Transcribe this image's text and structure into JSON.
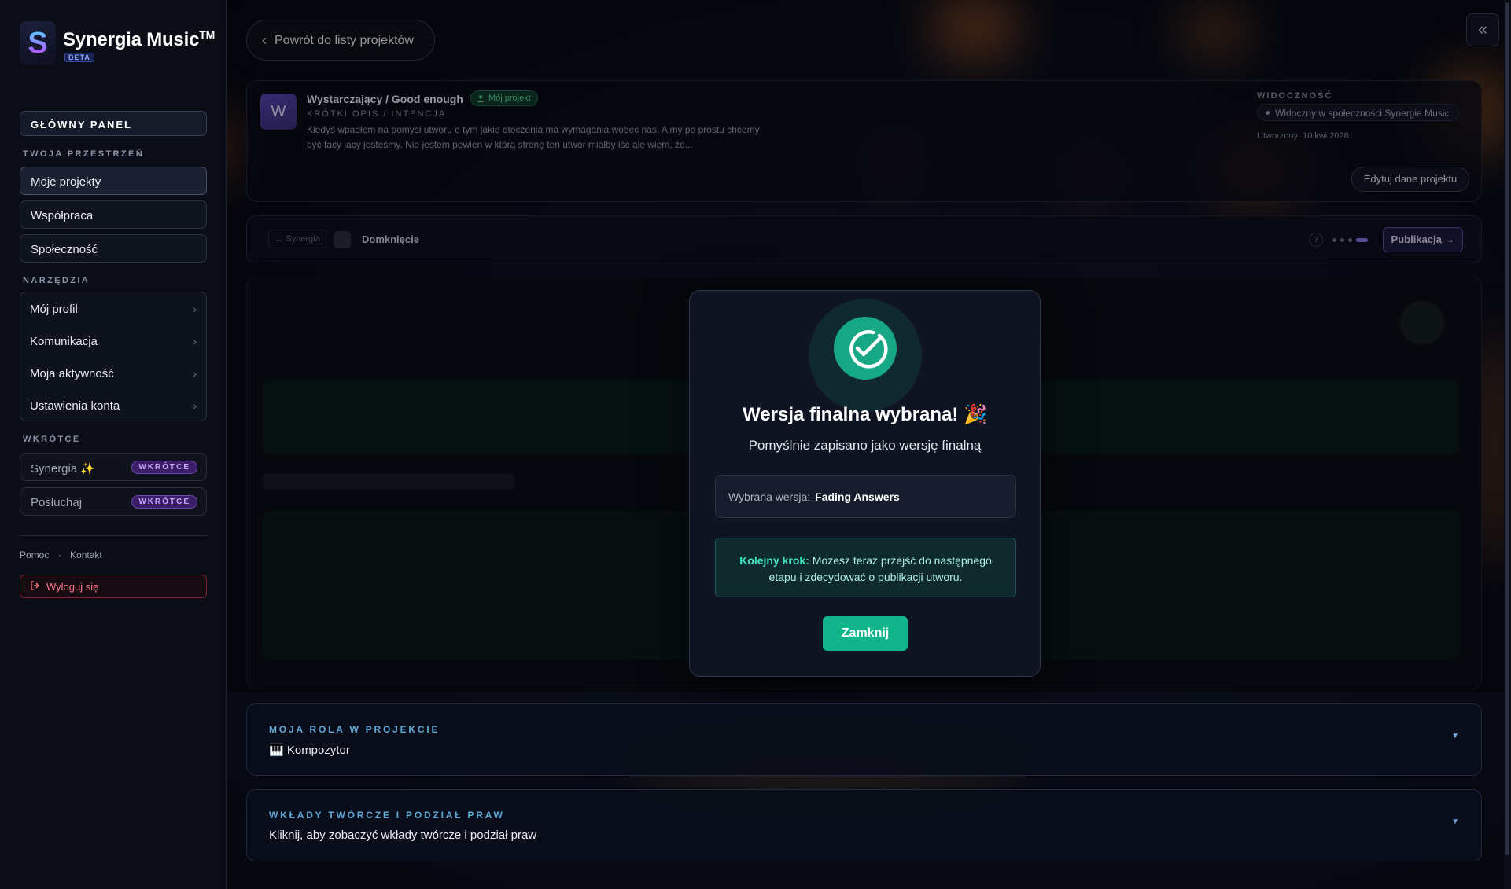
{
  "colors": {
    "accent": "#12b48c",
    "brand_purple": "#8a7cf0",
    "danger": "#ff7b8c"
  },
  "sidebar": {
    "brand": "Synergia Music",
    "brand_sup": "TM",
    "beta": "BETA",
    "main_panel": "GŁÓWNY PANEL",
    "workspace_label": "TWOJA PRZESTRZEŃ",
    "workspace_items": [
      {
        "label": "Moje projekty",
        "active": true
      },
      {
        "label": "Współpraca"
      },
      {
        "label": "Społeczność"
      }
    ],
    "tools_label": "NARZĘDZIA",
    "tools": [
      {
        "label": "Mój profil",
        "icon": "chevron-right-icon"
      },
      {
        "label": "Komunikacja",
        "icon": "chevron-right-icon"
      },
      {
        "label": "Moja aktywność",
        "icon": "chevron-right-icon"
      },
      {
        "label": "Ustawienia konta",
        "icon": "chevron-right-icon"
      }
    ],
    "soon_label": "WKRÓTCE",
    "soon_items": [
      {
        "label": "Synergia ✨",
        "badge": "WKRÓTCE"
      },
      {
        "label": "Posłuchaj",
        "badge": "WKRÓTCE"
      }
    ],
    "links": {
      "help": "Pomoc",
      "sep": "·",
      "contact": "Kontakt"
    },
    "logout": "Wyloguj się"
  },
  "header": {
    "back": "Powrót do listy projektów",
    "collapse_icon": "double-chevron-left-icon"
  },
  "project": {
    "avatar": "W",
    "title": "Wystarczający / Good enough",
    "badge": "Mój projekt",
    "short_label": "KRÓTKI OPIS / INTENCJA",
    "short_desc": "Kiedyś wpadłem na pomysł utworu o tym jakie otoczenia ma wymagania wobec nas. A my po prostu chcemy być tacy jacy jesteśmy. Nie jestem pewien w którą stronę ten utwór miałby iść ale wiem, że...",
    "visibility_label": "WIDOCZNOŚĆ",
    "visibility": "Widoczny w społeczności Synergia Music",
    "created": "Utworzony: 10 kwi 2026",
    "edit": "Edytuj dane projektu"
  },
  "stage": {
    "prev": "← Synergia",
    "name": "Domknięcie",
    "help": "?",
    "next": "Publikacja →",
    "steps_total": 4,
    "steps_current": 4
  },
  "modal": {
    "icon": "check-circle-icon",
    "title": "Wersja finalna wybrana! 🎉",
    "subtitle": "Pomyślnie zapisano jako wersję finalną",
    "version_label": "Wybrana wersja:",
    "version_value": "Fading Answers",
    "next_bold": "Kolejny krok:",
    "next_text": "Możesz teraz przejść do następnego etapu i zdecydować o publikacji utworu.",
    "close": "Zamknij"
  },
  "role_card": {
    "label": "MOJA ROLA W PROJEKCIE",
    "value": "🎹 Kompozytor"
  },
  "credits_card": {
    "label": "WKŁADY TWÓRCZE I PODZIAŁ PRAW",
    "value": "Kliknij, aby zobaczyć wkłady twórcze i podział praw"
  }
}
